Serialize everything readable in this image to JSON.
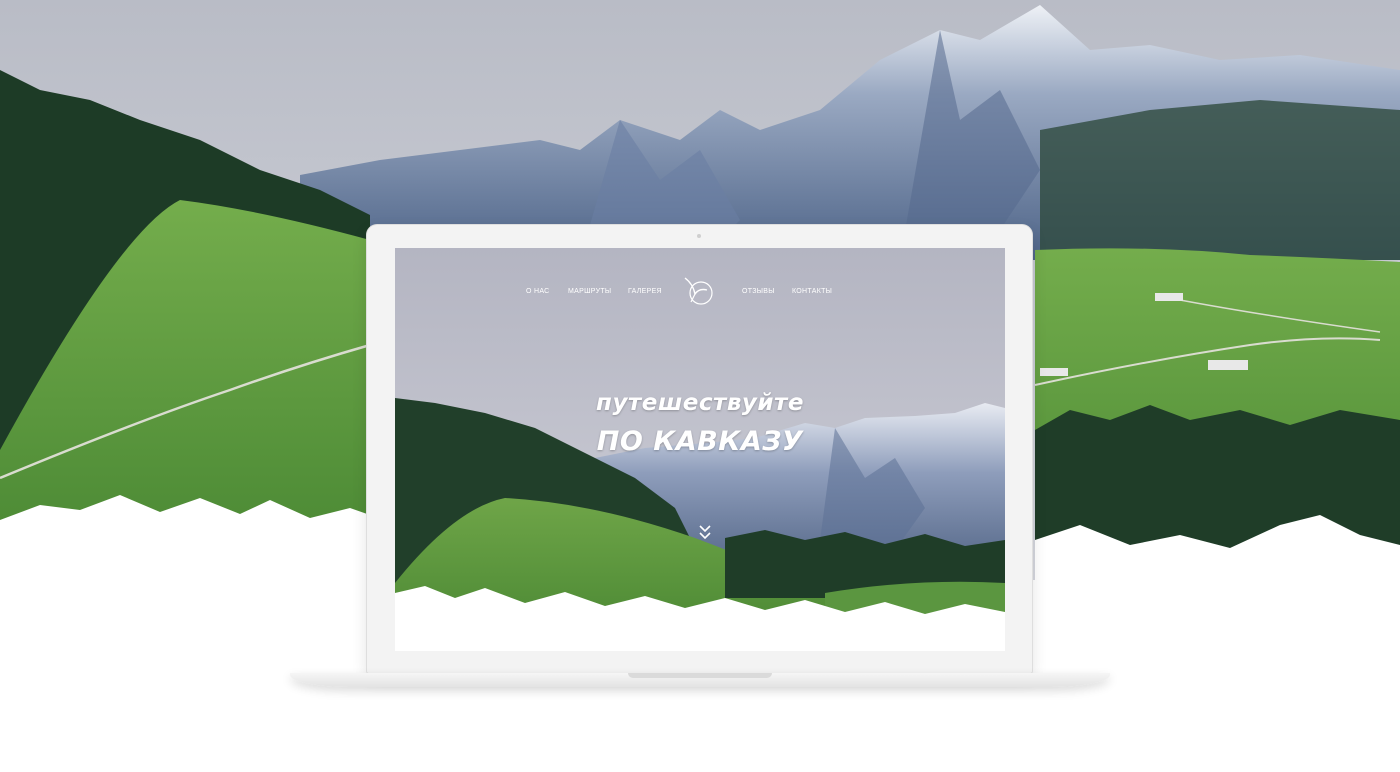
{
  "colors": {
    "sky": "#c5c7d2",
    "snow": "#ffffff",
    "meadow": "#5f9a3c",
    "forest": "#1f3d28",
    "mountain": "#5f7393"
  },
  "hero": {
    "nav_left": [
      "О НАС",
      "МАРШРУТЫ",
      "ГАЛЕРЕЯ"
    ],
    "nav_right": [
      "ОТЗЫВЫ",
      "КОНТАКТЫ"
    ],
    "logo_icon": "bird-logo-icon",
    "title_line1": "путешествуйте",
    "title_line2": "ПО КАВКАЗУ",
    "scroll_icon": "double-chevron-down-icon"
  }
}
